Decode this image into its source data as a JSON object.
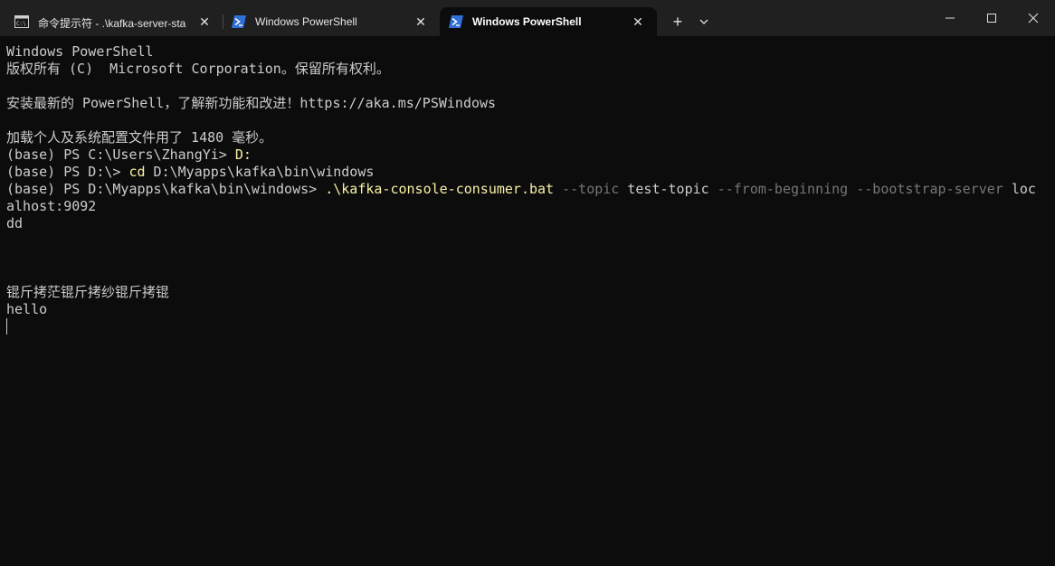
{
  "tabs": [
    {
      "title": "命令提示符 - .\\kafka-server-sta",
      "icon": "cmd-icon",
      "active": false
    },
    {
      "title": "Windows PowerShell",
      "icon": "powershell-icon",
      "active": false
    },
    {
      "title": "Windows PowerShell",
      "icon": "powershell-icon",
      "active": true
    }
  ],
  "titlebar": {
    "new_tab": "+",
    "close_glyph": "✕"
  },
  "terminal": {
    "lines": [
      "Windows PowerShell",
      "版权所有 (C)  Microsoft Corporation。保留所有权利。",
      "",
      "安装最新的 PowerShell，了解新功能和改进！https://aka.ms/PSWindows",
      "",
      "加载个人及系统配置文件用了 1480 毫秒。"
    ],
    "prompt1": {
      "prompt": "(base) PS C:\\Users\\ZhangYi> ",
      "cmd": "D:"
    },
    "prompt2": {
      "prompt": "(base) PS D:\\> ",
      "cmd": "cd",
      "arg": " D:\\Myapps\\kafka\\bin\\windows"
    },
    "prompt3": {
      "prompt": "(base) PS D:\\Myapps\\kafka\\bin\\windows> ",
      "cmd": ".\\kafka-console-consumer.bat",
      "p1": " --topic",
      "a1": " test-topic",
      "p2": " --from-beginning",
      "p3": " --bootstrap-server",
      "a2": " loc"
    },
    "wrap": "alhost:9092",
    "output": [
      "dd",
      "",
      "",
      "",
      "锟斤拷茫锟斤拷纱锟斤拷锟",
      "hello"
    ]
  },
  "colors": {
    "background": "#0c0c0c",
    "tabbar": "#202020",
    "text": "#cccccc",
    "command": "#f9f1a5",
    "parameter": "#767676",
    "powershell_icon": "#2f6fd8"
  }
}
